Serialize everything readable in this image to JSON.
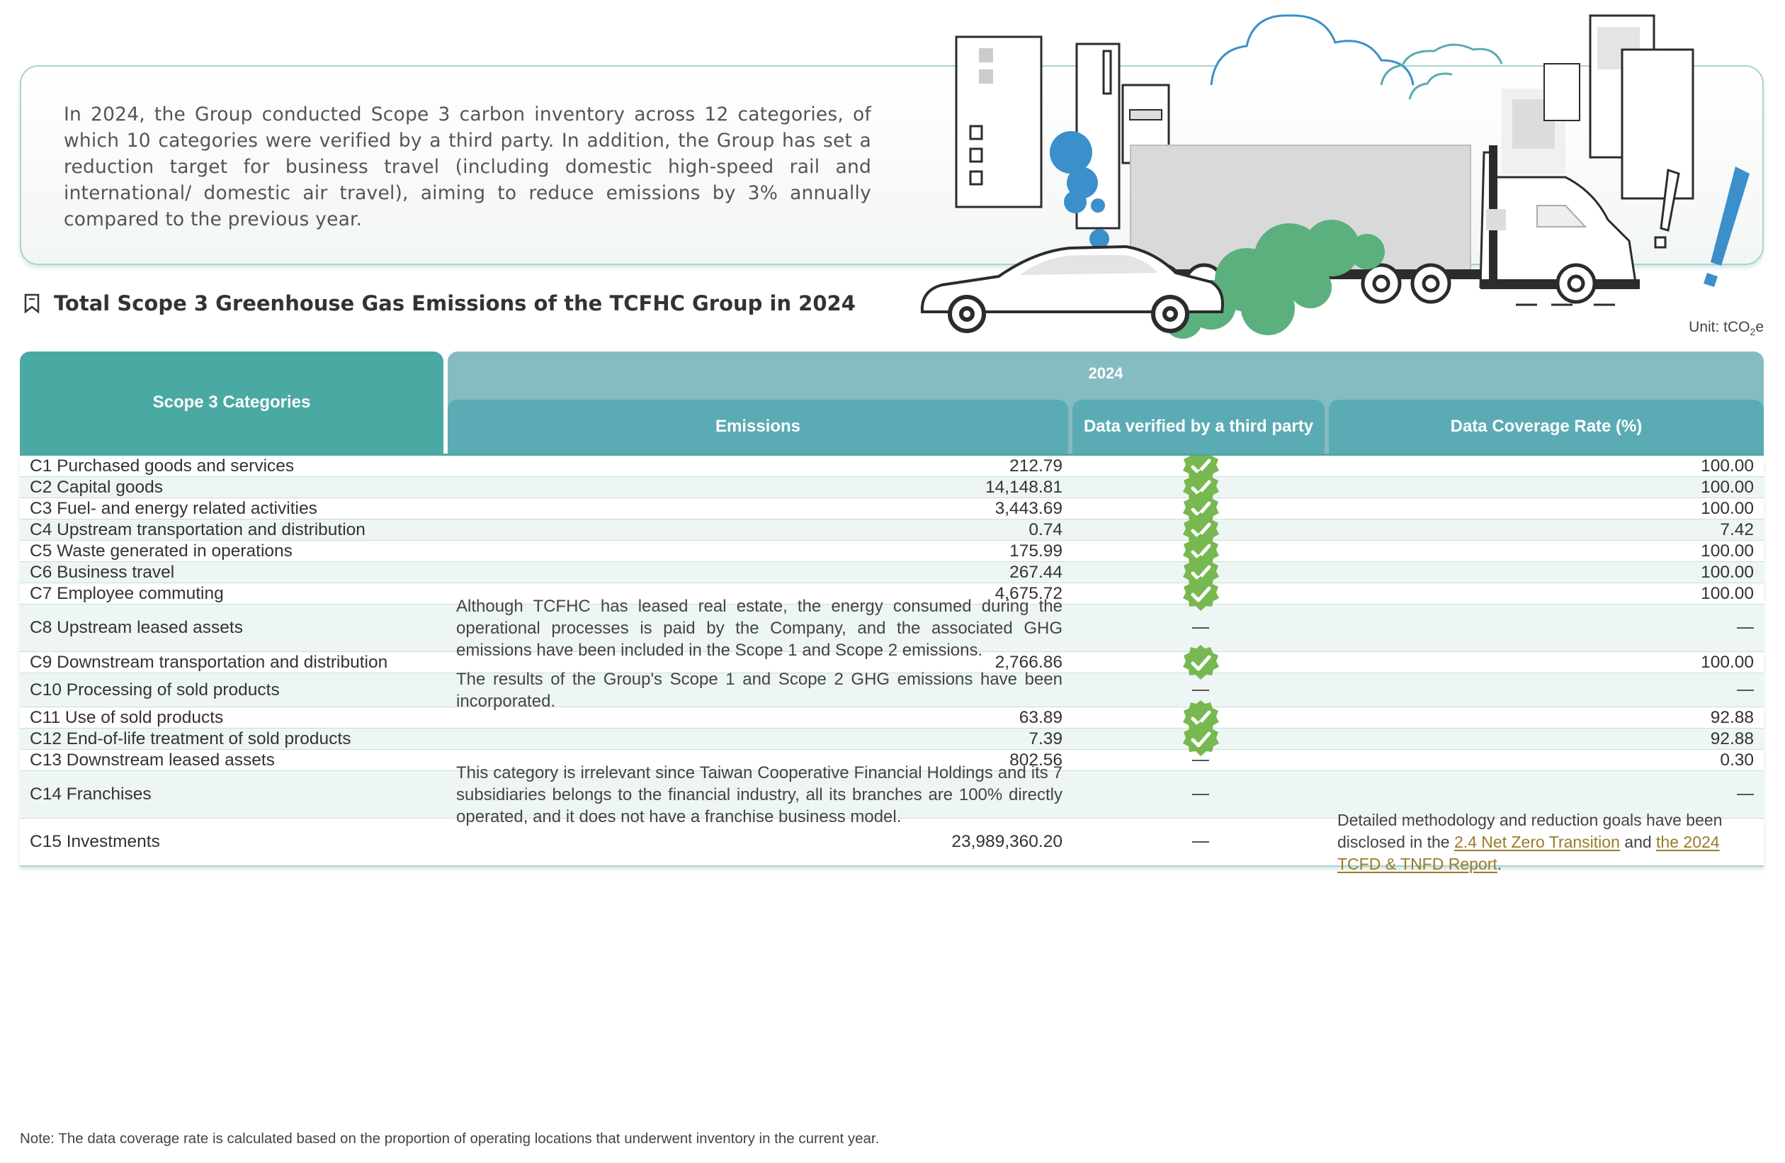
{
  "intro": {
    "text": "In 2024, the Group conducted Scope 3 carbon inventory across 12 categories, of which 10 categories were verified by a third party. In addition, the Group has set a reduction target for business travel (including domestic high-speed rail and international/ domestic air travel), aiming to reduce emissions by 3% annually compared to the previous year."
  },
  "section": {
    "title": "Total Scope 3 Greenhouse Gas Emissions of the TCFHC Group in 2024",
    "unit_prefix": "Unit: tCO",
    "unit_sub": "2",
    "unit_suffix": "e"
  },
  "table": {
    "col_category": "Scope 3 Categories",
    "col_year": "2024",
    "col_emissions": "Emissions",
    "col_verified": "Data verified by a third party",
    "col_coverage": "Data Coverage Rate (%)",
    "rows": [
      {
        "category": "C1 Purchased goods and services",
        "emissions": "212.79",
        "verified": true,
        "coverage": "100.00"
      },
      {
        "category": "C2 Capital goods",
        "emissions": "14,148.81",
        "verified": true,
        "coverage": "100.00"
      },
      {
        "category": "C3 Fuel- and energy related activities",
        "emissions": "3,443.69",
        "verified": true,
        "coverage": "100.00"
      },
      {
        "category": "C4 Upstream transportation and distribution",
        "emissions": "0.74",
        "verified": true,
        "coverage": "7.42"
      },
      {
        "category": "C5 Waste generated in operations",
        "emissions": "175.99",
        "verified": true,
        "coverage": "100.00"
      },
      {
        "category": "C6 Business travel",
        "emissions": "267.44",
        "verified": true,
        "coverage": "100.00"
      },
      {
        "category": "C7 Employee commuting",
        "emissions": "4,675.72",
        "verified": true,
        "coverage": "100.00"
      },
      {
        "category": "C8 Upstream leased assets",
        "emissions_note": "Although TCFHC has leased real estate, the energy consumed during the operational processes is paid by the Company, and the associated GHG emissions have been included in the Scope 1 and Scope 2 emissions.",
        "verified": false,
        "coverage": ""
      },
      {
        "category": "C9 Downstream transportation and distribution",
        "emissions": "2,766.86",
        "verified": true,
        "coverage": "100.00"
      },
      {
        "category": "C10 Processing of sold products",
        "emissions_note": "The results of the Group's Scope 1 and Scope 2 GHG emissions have been incorporated.",
        "verified": false,
        "coverage": ""
      },
      {
        "category": "C11 Use of sold products",
        "emissions": "63.89",
        "verified": true,
        "coverage": "92.88"
      },
      {
        "category": "C12 End-of-life treatment of sold products",
        "emissions": "7.39",
        "verified": true,
        "coverage": "92.88"
      },
      {
        "category": "C13 Downstream leased assets",
        "emissions": "802.56",
        "verified": false,
        "coverage": "0.30"
      },
      {
        "category": "C14 Franchises",
        "emissions_note": "This category is irrelevant since Taiwan Cooperative Financial Holdings and its 7 subsidiaries belongs to the financial industry, all its branches are 100% directly operated, and it does not have a franchise business model.",
        "verified": false,
        "coverage": ""
      },
      {
        "category": "C15 Investments",
        "emissions": "23,989,360.20",
        "verified": false,
        "coverage_note": {
          "before": "Detailed methodology and reduction goals have been disclosed in the ",
          "link1": "2.4 Net Zero Transition",
          "middle": " and ",
          "link2": "the 2024 TCFD & TNFD Report",
          "after": "."
        }
      }
    ]
  },
  "footnote": "Note: The data coverage rate is calculated based on the proportion of operating locations that underwent inventory in the current year.",
  "colors": {
    "header_teal": "#4aa9a2",
    "header_light": "#85bcc1",
    "header_mid": "#5aabb4",
    "check_green": "#78b850",
    "link_gold": "#9b7a2b"
  }
}
